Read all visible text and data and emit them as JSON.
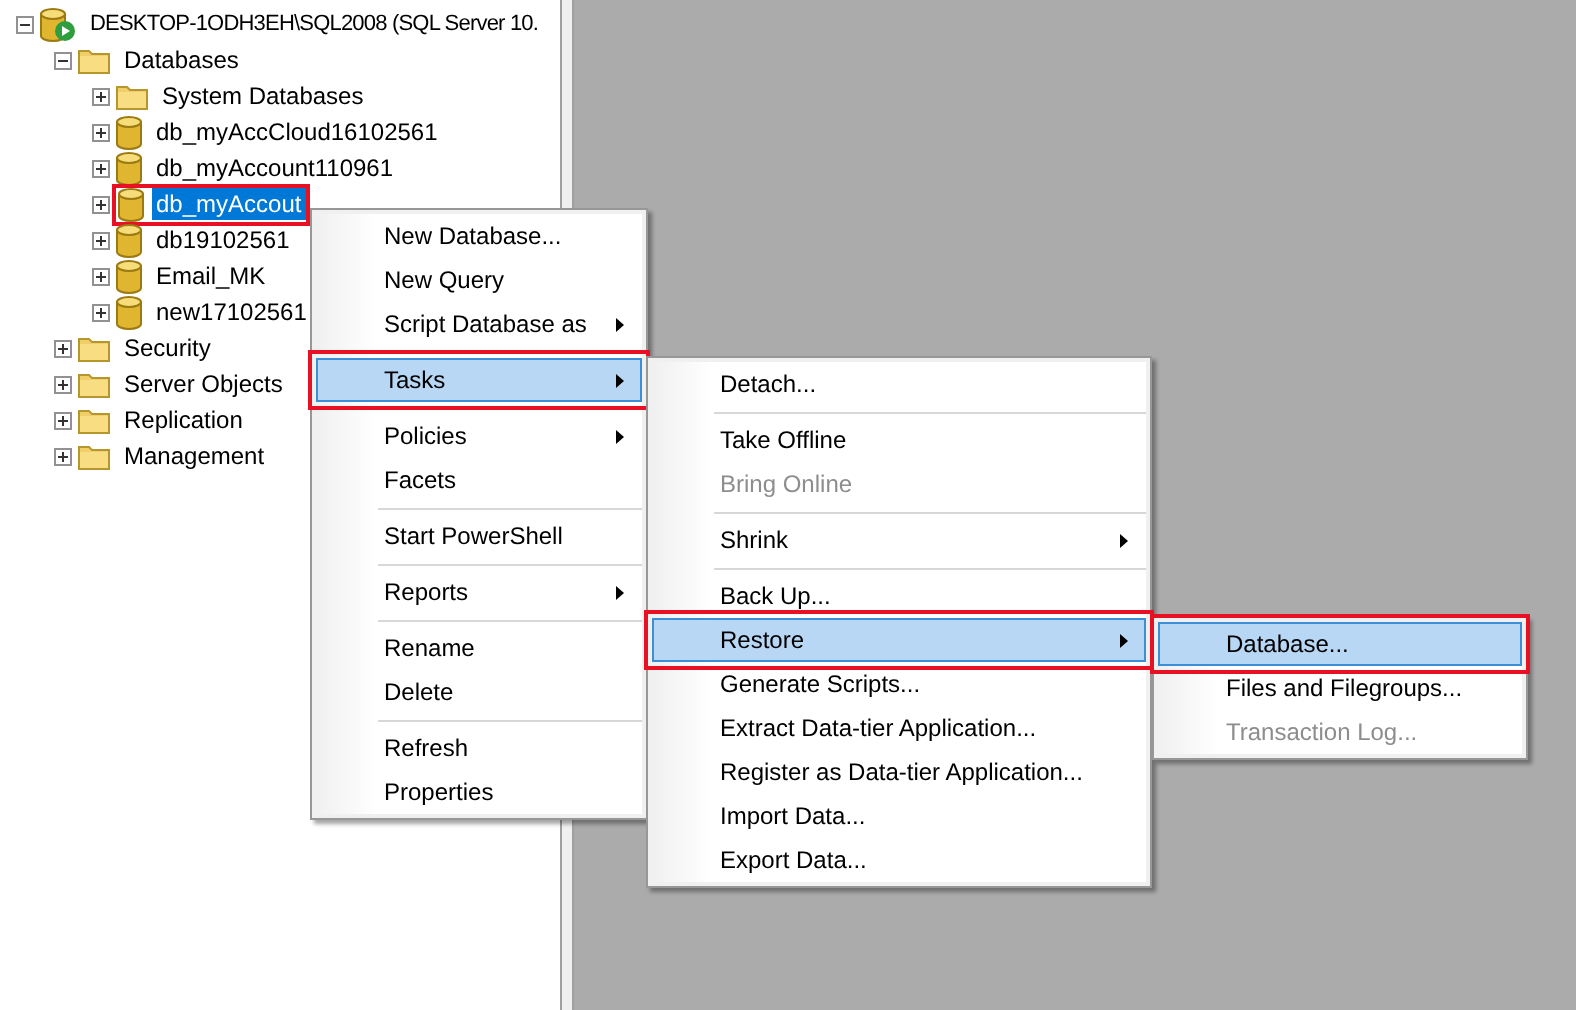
{
  "tree": [
    {
      "label": "DESKTOP-1ODH3EH\\SQL2008 (SQL Server 10.",
      "kind": "server",
      "expanded": true,
      "selected": false,
      "children": [
        {
          "label": "Databases",
          "kind": "folder",
          "expanded": true,
          "selected": false,
          "children": [
            {
              "label": "System Databases",
              "kind": "folder",
              "expanded": false,
              "selected": false
            },
            {
              "label": "db_myAccCloud16102561",
              "kind": "database",
              "expanded": false,
              "selected": false
            },
            {
              "label": "db_myAccount110961",
              "kind": "database",
              "expanded": false,
              "selected": false
            },
            {
              "label": "db_myAccout",
              "kind": "database",
              "expanded": false,
              "selected": true
            },
            {
              "label": "db19102561",
              "kind": "database",
              "expanded": false,
              "selected": false
            },
            {
              "label": "Email_MK",
              "kind": "database",
              "expanded": false,
              "selected": false
            },
            {
              "label": "new17102561",
              "kind": "database",
              "expanded": false,
              "selected": false
            }
          ]
        },
        {
          "label": "Security",
          "kind": "folder",
          "expanded": false,
          "selected": false
        },
        {
          "label": "Server Objects",
          "kind": "folder",
          "expanded": false,
          "selected": false
        },
        {
          "label": "Replication",
          "kind": "folder",
          "expanded": false,
          "selected": false
        },
        {
          "label": "Management",
          "kind": "folder",
          "expanded": false,
          "selected": false
        }
      ]
    }
  ],
  "menus": [
    {
      "items": [
        {
          "kind": "item",
          "label": "New Database...",
          "submenu": false,
          "disabled": false,
          "selected": false
        },
        {
          "kind": "item",
          "label": "New Query",
          "submenu": false,
          "disabled": false,
          "selected": false
        },
        {
          "kind": "item",
          "label": "Script Database as",
          "submenu": true,
          "disabled": false,
          "selected": false
        },
        {
          "kind": "separator"
        },
        {
          "kind": "item",
          "label": "Tasks",
          "submenu": true,
          "disabled": false,
          "selected": true
        },
        {
          "kind": "separator"
        },
        {
          "kind": "item",
          "label": "Policies",
          "submenu": true,
          "disabled": false,
          "selected": false
        },
        {
          "kind": "item",
          "label": "Facets",
          "submenu": false,
          "disabled": false,
          "selected": false
        },
        {
          "kind": "separator"
        },
        {
          "kind": "item",
          "label": "Start PowerShell",
          "submenu": false,
          "disabled": false,
          "selected": false
        },
        {
          "kind": "separator"
        },
        {
          "kind": "item",
          "label": "Reports",
          "submenu": true,
          "disabled": false,
          "selected": false
        },
        {
          "kind": "separator"
        },
        {
          "kind": "item",
          "label": "Rename",
          "submenu": false,
          "disabled": false,
          "selected": false
        },
        {
          "kind": "item",
          "label": "Delete",
          "submenu": false,
          "disabled": false,
          "selected": false
        },
        {
          "kind": "separator"
        },
        {
          "kind": "item",
          "label": "Refresh",
          "submenu": false,
          "disabled": false,
          "selected": false
        },
        {
          "kind": "item",
          "label": "Properties",
          "submenu": false,
          "disabled": false,
          "selected": false
        }
      ]
    },
    {
      "items": [
        {
          "kind": "item",
          "label": "Detach...",
          "submenu": false,
          "disabled": false,
          "selected": false
        },
        {
          "kind": "separator"
        },
        {
          "kind": "item",
          "label": "Take Offline",
          "submenu": false,
          "disabled": false,
          "selected": false
        },
        {
          "kind": "item",
          "label": "Bring Online",
          "submenu": false,
          "disabled": true,
          "selected": false
        },
        {
          "kind": "separator"
        },
        {
          "kind": "item",
          "label": "Shrink",
          "submenu": true,
          "disabled": false,
          "selected": false
        },
        {
          "kind": "separator"
        },
        {
          "kind": "item",
          "label": "Back Up...",
          "submenu": false,
          "disabled": false,
          "selected": false
        },
        {
          "kind": "item",
          "label": "Restore",
          "submenu": true,
          "disabled": false,
          "selected": true
        },
        {
          "kind": "item",
          "label": "Generate Scripts...",
          "submenu": false,
          "disabled": false,
          "selected": false
        },
        {
          "kind": "item",
          "label": "Extract Data-tier Application...",
          "submenu": false,
          "disabled": false,
          "selected": false
        },
        {
          "kind": "item",
          "label": "Register as Data-tier Application...",
          "submenu": false,
          "disabled": false,
          "selected": false
        },
        {
          "kind": "item",
          "label": "Import Data...",
          "submenu": false,
          "disabled": false,
          "selected": false
        },
        {
          "kind": "item",
          "label": "Export Data...",
          "submenu": false,
          "disabled": false,
          "selected": false
        }
      ]
    },
    {
      "items": [
        {
          "kind": "item",
          "label": "Database...",
          "submenu": false,
          "disabled": false,
          "selected": true
        },
        {
          "kind": "item",
          "label": "Files and Filegroups...",
          "submenu": false,
          "disabled": false,
          "selected": false
        },
        {
          "kind": "item",
          "label": "Transaction Log...",
          "submenu": false,
          "disabled": true,
          "selected": false
        }
      ]
    }
  ]
}
